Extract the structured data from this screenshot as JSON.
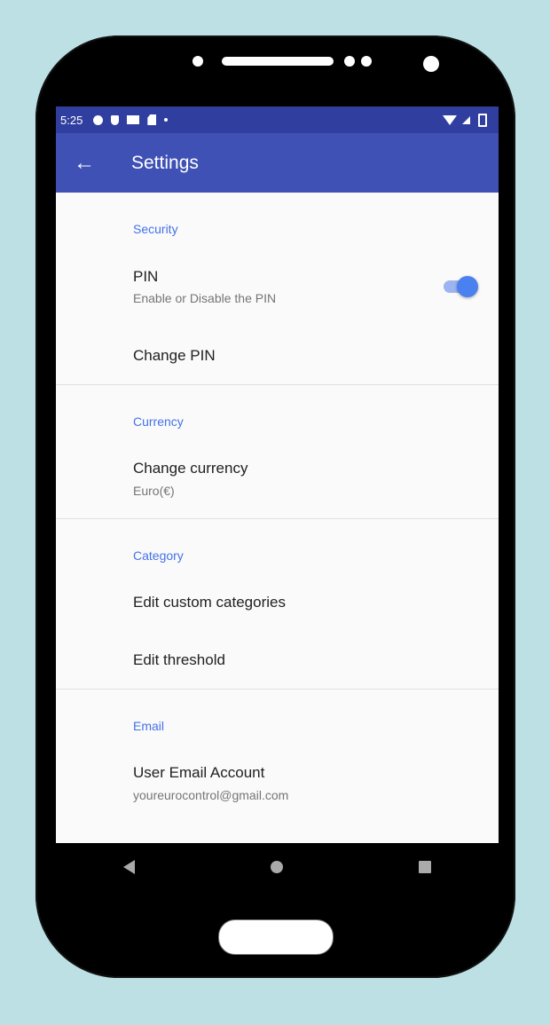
{
  "status_bar": {
    "time": "5:25"
  },
  "app_bar": {
    "back_icon": "arrow-back-icon",
    "title": "Settings"
  },
  "sections": {
    "security": {
      "header": "Security",
      "pin": {
        "title": "PIN",
        "subtitle": "Enable or Disable the PIN",
        "enabled": true
      },
      "change_pin": {
        "title": "Change PIN"
      }
    },
    "currency": {
      "header": "Currency",
      "change_currency": {
        "title": "Change currency",
        "subtitle": "Euro(€)"
      }
    },
    "category": {
      "header": "Category",
      "edit_custom": {
        "title": "Edit custom categories"
      },
      "edit_threshold": {
        "title": "Edit threshold"
      }
    },
    "email": {
      "header": "Email",
      "user_email": {
        "title": "User Email Account",
        "subtitle": "youreurocontrol@gmail.com"
      }
    }
  },
  "colors": {
    "primary": "#3f51b5",
    "primary_dark": "#303f9f",
    "accent": "#4472e8",
    "background": "#bde0e4"
  }
}
